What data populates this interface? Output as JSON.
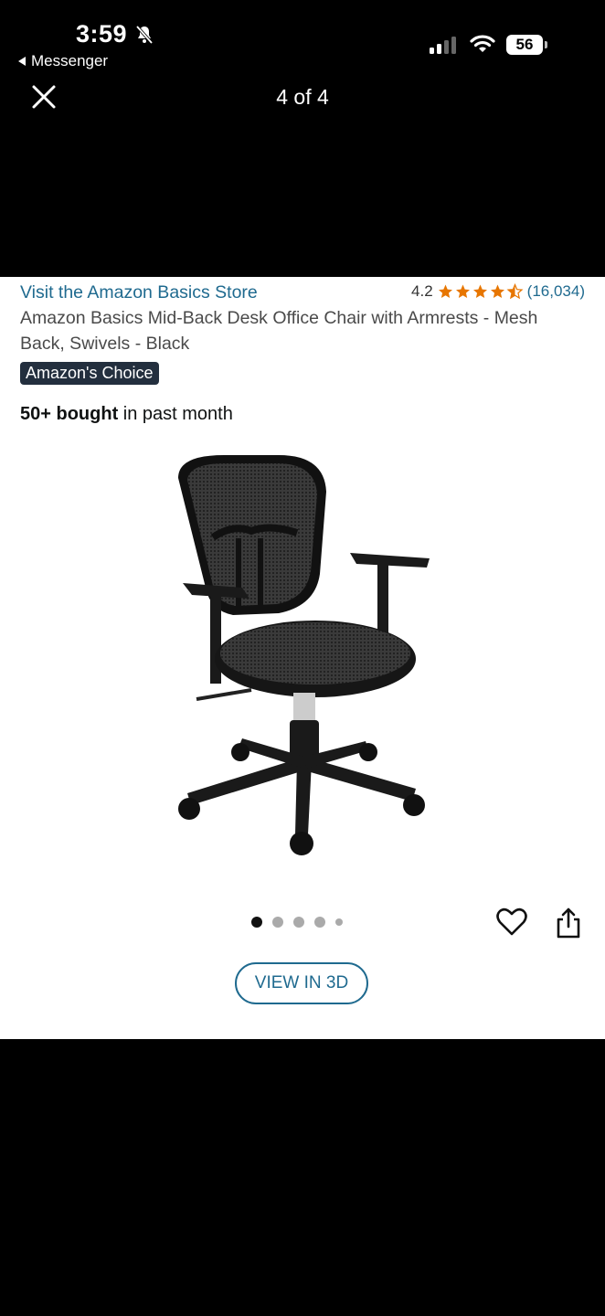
{
  "status_bar": {
    "time": "3:59",
    "back_app": "Messenger",
    "battery": "56"
  },
  "viewer": {
    "counter": "4 of 4"
  },
  "product": {
    "store_link": "Visit the Amazon Basics Store",
    "rating_value": "4.2",
    "rating_count": "(16,034)",
    "rating_stars": 4.2,
    "title": "Amazon Basics Mid-Back Desk Office Chair with Armrests - Mesh Back, Swivels - Black",
    "badge": "Amazon's Choice",
    "bought_bold": "50+ bought",
    "bought_rest": " in past month",
    "image_count": 5,
    "active_image_index": 0,
    "view_3d_label": "VIEW IN 3D"
  },
  "colors": {
    "link": "#1f6a8f",
    "star": "#e77600",
    "badge_bg": "#232f3e"
  },
  "icons": [
    "bell-slash-icon",
    "signal-icon",
    "wifi-icon",
    "battery-icon",
    "close-icon",
    "star-icon",
    "heart-icon",
    "share-icon"
  ]
}
